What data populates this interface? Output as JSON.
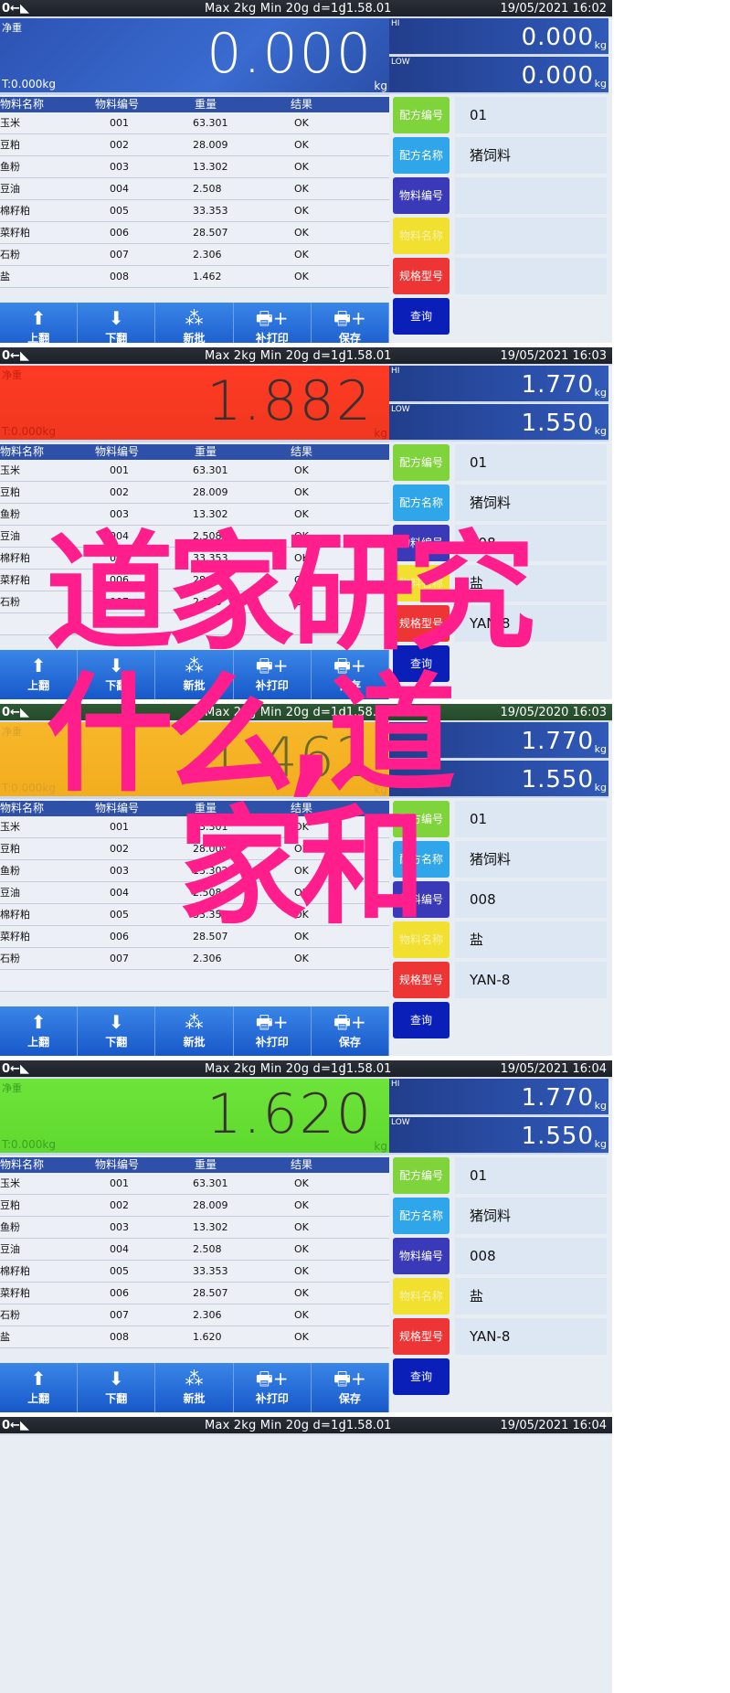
{
  "common": {
    "zero_indicator": "0←◣",
    "spec": "Max 2kg  Min 20g  d=1g",
    "version": "J1.58.01",
    "net_label": "净重",
    "tare": "T:0.000kg",
    "unit": "kg",
    "hi_label": "HI",
    "low_label": "LOW",
    "table_headers": [
      "物料名称",
      "物料编号",
      "重量",
      "结果"
    ],
    "toolbar": [
      {
        "icon": "arrow-up-icon",
        "glyph": "⬆",
        "label": "上翻"
      },
      {
        "icon": "arrow-down-icon",
        "glyph": "⬇",
        "label": "下翻"
      },
      {
        "icon": "new-batch-icon",
        "glyph": "⁂",
        "label": "新批"
      },
      {
        "icon": "printer-plus-icon",
        "glyph": "🖶+",
        "label": "补打印"
      },
      {
        "icon": "printer-plus-icon",
        "glyph": "🖶+",
        "label": "保存"
      }
    ],
    "side_buttons": [
      {
        "label": "配方编号",
        "color": "#7ed43a"
      },
      {
        "label": "配方名称",
        "color": "#2fa6ea"
      },
      {
        "label": "物料编号",
        "color": "#3a3ab8"
      },
      {
        "label": "物料名称",
        "color": "#f2e030"
      },
      {
        "label": "规格型号",
        "color": "#ee3535"
      },
      {
        "label": "查询",
        "color": "#0a1fb8"
      }
    ]
  },
  "screens": [
    {
      "datetime": "19/05/2021  16:02",
      "weight": "0.000",
      "state": "blue",
      "hi": "0.000",
      "low": "0.000",
      "rows": [
        [
          "玉米",
          "001",
          "63.301",
          "OK"
        ],
        [
          "豆粕",
          "002",
          "28.009",
          "OK"
        ],
        [
          "鱼粉",
          "003",
          "13.302",
          "OK"
        ],
        [
          "豆油",
          "004",
          "2.508",
          "OK"
        ],
        [
          "棉籽粕",
          "005",
          "33.353",
          "OK"
        ],
        [
          "菜籽粕",
          "006",
          "28.507",
          "OK"
        ],
        [
          "石粉",
          "007",
          "2.306",
          "OK"
        ],
        [
          "盐",
          "008",
          "1.462",
          "OK"
        ]
      ],
      "side_values": [
        "01",
        "猪饲料",
        "",
        "",
        "",
        ""
      ]
    },
    {
      "datetime": "19/05/2021  16:03",
      "weight": "1.882",
      "state": "red",
      "hi": "1.770",
      "low": "1.550",
      "rows": [
        [
          "玉米",
          "001",
          "63.301",
          "OK"
        ],
        [
          "豆粕",
          "002",
          "28.009",
          "OK"
        ],
        [
          "鱼粉",
          "003",
          "13.302",
          "OK"
        ],
        [
          "豆油",
          "004",
          "2.508",
          "OK"
        ],
        [
          "棉籽粕",
          "005",
          "33.353",
          "OK"
        ],
        [
          "菜籽粕",
          "006",
          "28.507",
          "OK"
        ],
        [
          "石粉",
          "007",
          "2.306",
          "OK"
        ]
      ],
      "side_values": [
        "01",
        "猪饲料",
        "008",
        "盐",
        "YAN-8",
        ""
      ]
    },
    {
      "datetime": "19/05/2020  16:03",
      "weight": "1.462",
      "state": "orange",
      "hi": "1.770",
      "low": "1.550",
      "rows": [
        [
          "玉米",
          "001",
          "63.301",
          "OK"
        ],
        [
          "豆粕",
          "002",
          "28.009",
          "OK"
        ],
        [
          "鱼粉",
          "003",
          "13.302",
          "OK"
        ],
        [
          "豆油",
          "004",
          "2.508",
          "OK"
        ],
        [
          "棉籽粕",
          "005",
          "33.353",
          "OK"
        ],
        [
          "菜籽粕",
          "006",
          "28.507",
          "OK"
        ],
        [
          "石粉",
          "007",
          "2.306",
          "OK"
        ]
      ],
      "side_values": [
        "01",
        "猪饲料",
        "008",
        "盐",
        "YAN-8",
        ""
      ]
    },
    {
      "datetime": "19/05/2021  16:04",
      "weight": "1.620",
      "state": "lime",
      "hi": "1.770",
      "low": "1.550",
      "rows": [
        [
          "玉米",
          "001",
          "63.301",
          "OK"
        ],
        [
          "豆粕",
          "002",
          "28.009",
          "OK"
        ],
        [
          "鱼粉",
          "003",
          "13.302",
          "OK"
        ],
        [
          "豆油",
          "004",
          "2.508",
          "OK"
        ],
        [
          "棉籽粕",
          "005",
          "33.353",
          "OK"
        ],
        [
          "菜籽粕",
          "006",
          "28.507",
          "OK"
        ],
        [
          "石粉",
          "007",
          "2.306",
          "OK"
        ],
        [
          "盐",
          "008",
          "1.620",
          "OK"
        ]
      ],
      "side_values": [
        "01",
        "猪饲料",
        "008",
        "盐",
        "YAN-8",
        ""
      ]
    }
  ],
  "partial_status": {
    "datetime": "19/05/2021  16:04"
  },
  "overlay": {
    "line1": "道家研究",
    "line2": "什么,道",
    "line3": "家和",
    "color": "#ff1e8c"
  }
}
